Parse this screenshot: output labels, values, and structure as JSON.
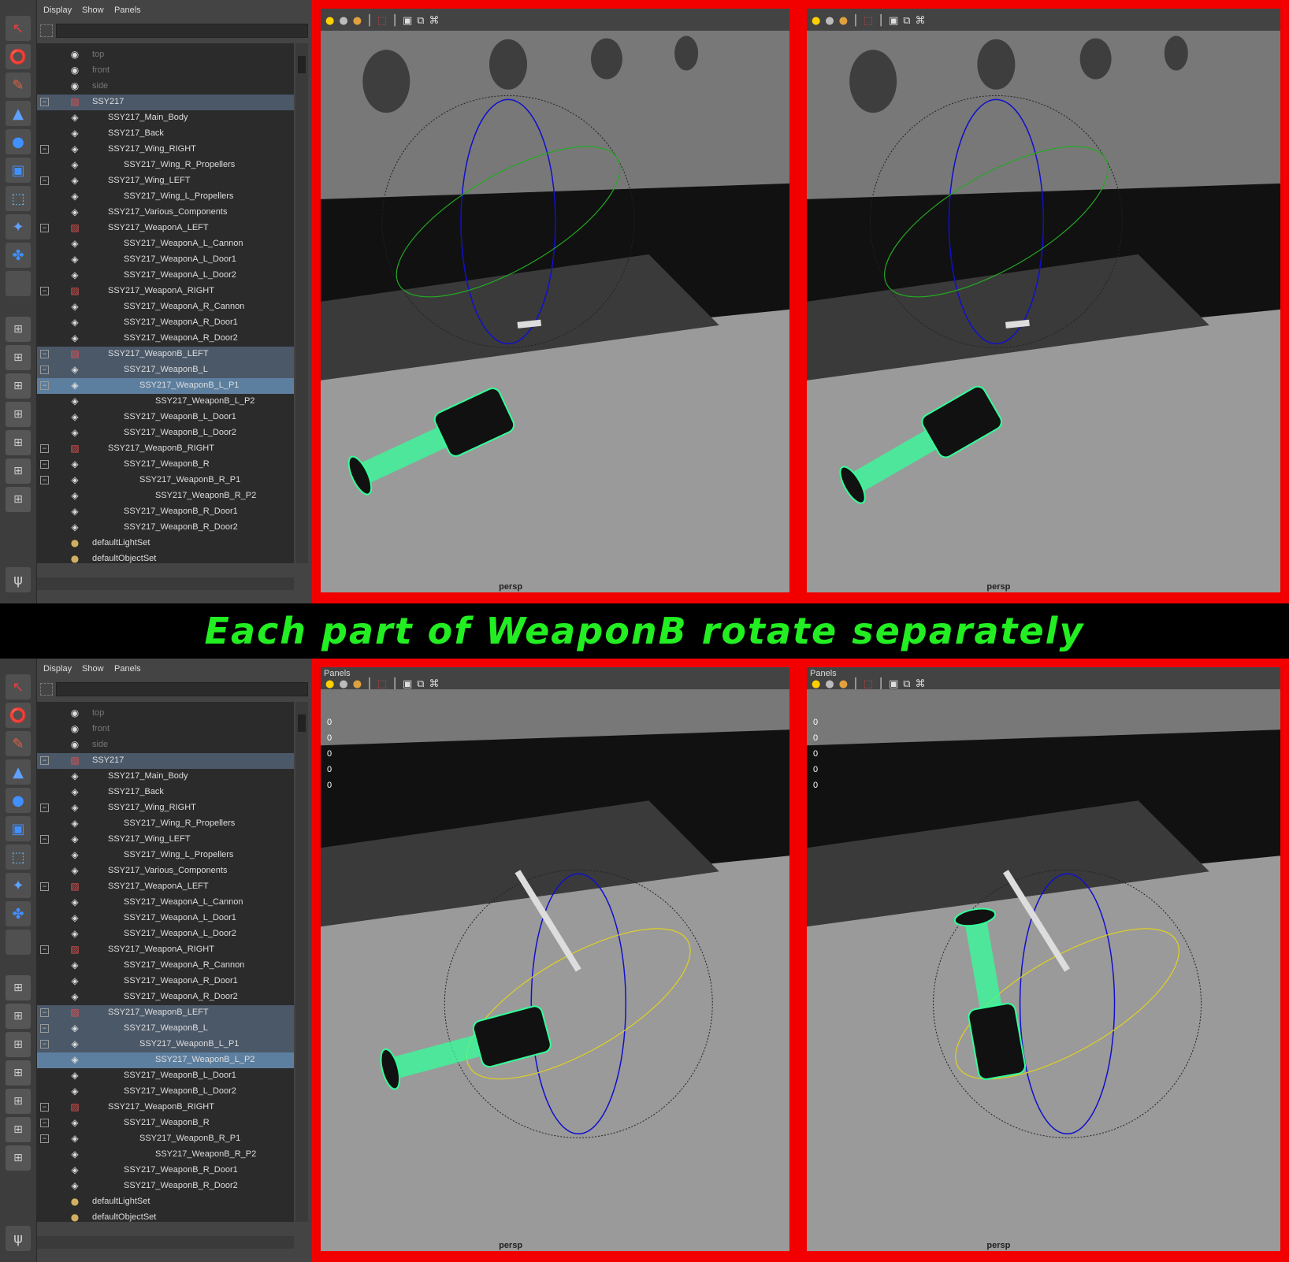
{
  "banner": {
    "text": "Each part of WeaponB rotate separately"
  },
  "outliner": {
    "menu": [
      "Display",
      "Show",
      "Panels"
    ],
    "items": [
      {
        "label": "top",
        "icon": "camera-icon",
        "indent": 0,
        "dim": true
      },
      {
        "label": "front",
        "icon": "camera-icon",
        "indent": 0,
        "dim": true
      },
      {
        "label": "side",
        "icon": "camera-icon",
        "indent": 0,
        "dim": true
      },
      {
        "label": "SSY217",
        "icon": "group-icon",
        "indent": 0,
        "exp": true
      },
      {
        "label": "SSY217_Main_Body",
        "icon": "mesh-icon",
        "indent": 1
      },
      {
        "label": "SSY217_Back",
        "icon": "mesh-icon",
        "indent": 1
      },
      {
        "label": "SSY217_Wing_RIGHT",
        "icon": "mesh-icon",
        "indent": 1,
        "exp": true
      },
      {
        "label": "SSY217_Wing_R_Propellers",
        "icon": "mesh-icon",
        "indent": 2
      },
      {
        "label": "SSY217_Wing_LEFT",
        "icon": "mesh-icon",
        "indent": 1,
        "exp": true
      },
      {
        "label": "SSY217_Wing_L_Propellers",
        "icon": "mesh-icon",
        "indent": 2
      },
      {
        "label": "SSY217_Various_Components",
        "icon": "mesh-icon",
        "indent": 1
      },
      {
        "label": "SSY217_WeaponA_LEFT",
        "icon": "group-icon",
        "indent": 1,
        "exp": true
      },
      {
        "label": "SSY217_WeaponA_L_Cannon",
        "icon": "mesh-icon",
        "indent": 2
      },
      {
        "label": "SSY217_WeaponA_L_Door1",
        "icon": "mesh-icon",
        "indent": 2
      },
      {
        "label": "SSY217_WeaponA_L_Door2",
        "icon": "mesh-icon",
        "indent": 2
      },
      {
        "label": "SSY217_WeaponA_RIGHT",
        "icon": "group-icon",
        "indent": 1,
        "exp": true
      },
      {
        "label": "SSY217_WeaponA_R_Cannon",
        "icon": "mesh-icon",
        "indent": 2
      },
      {
        "label": "SSY217_WeaponA_R_Door1",
        "icon": "mesh-icon",
        "indent": 2
      },
      {
        "label": "SSY217_WeaponA_R_Door2",
        "icon": "mesh-icon",
        "indent": 2
      },
      {
        "label": "SSY217_WeaponB_LEFT",
        "icon": "group-icon",
        "indent": 1,
        "exp": true
      },
      {
        "label": "SSY217_WeaponB_L",
        "icon": "mesh-icon",
        "indent": 2,
        "exp": true
      },
      {
        "label": "SSY217_WeaponB_L_P1",
        "icon": "mesh-icon",
        "indent": 3,
        "exp": true
      },
      {
        "label": "SSY217_WeaponB_L_P2",
        "icon": "mesh-icon",
        "indent": 4
      },
      {
        "label": "SSY217_WeaponB_L_Door1",
        "icon": "mesh-icon",
        "indent": 2
      },
      {
        "label": "SSY217_WeaponB_L_Door2",
        "icon": "mesh-icon",
        "indent": 2
      },
      {
        "label": "SSY217_WeaponB_RIGHT",
        "icon": "group-icon",
        "indent": 1,
        "exp": true
      },
      {
        "label": "SSY217_WeaponB_R",
        "icon": "mesh-icon",
        "indent": 2,
        "exp": true
      },
      {
        "label": "SSY217_WeaponB_R_P1",
        "icon": "mesh-icon",
        "indent": 3,
        "exp": true
      },
      {
        "label": "SSY217_WeaponB_R_P2",
        "icon": "mesh-icon",
        "indent": 4
      },
      {
        "label": "SSY217_WeaponB_R_Door1",
        "icon": "mesh-icon",
        "indent": 2
      },
      {
        "label": "SSY217_WeaponB_R_Door2",
        "icon": "mesh-icon",
        "indent": 2
      },
      {
        "label": "defaultLightSet",
        "icon": "set-icon",
        "indent": 0
      },
      {
        "label": "defaultObjectSet",
        "icon": "set-icon",
        "indent": 0
      }
    ]
  },
  "top_panel": {
    "highlighted_rows": [
      3,
      19,
      20,
      21
    ],
    "selected_row": 21,
    "viewports": [
      {
        "panels_label": "",
        "camera": "persp",
        "hud": []
      },
      {
        "panels_label": "",
        "camera": "persp",
        "hud": []
      }
    ]
  },
  "bottom_panel": {
    "highlighted_rows": [
      3,
      19,
      20,
      21,
      22
    ],
    "selected_row": 22,
    "viewports": [
      {
        "panels_label": "Panels",
        "camera": "persp",
        "hud": [
          "0",
          "0",
          "0",
          "0",
          "0"
        ]
      },
      {
        "panels_label": "Panels",
        "camera": "persp",
        "hud": [
          "0",
          "0",
          "0",
          "0",
          "0"
        ]
      }
    ]
  },
  "colors": {
    "frame": "#f20000",
    "banner_text": "#22ee22",
    "wireframe": "#33ff99"
  }
}
